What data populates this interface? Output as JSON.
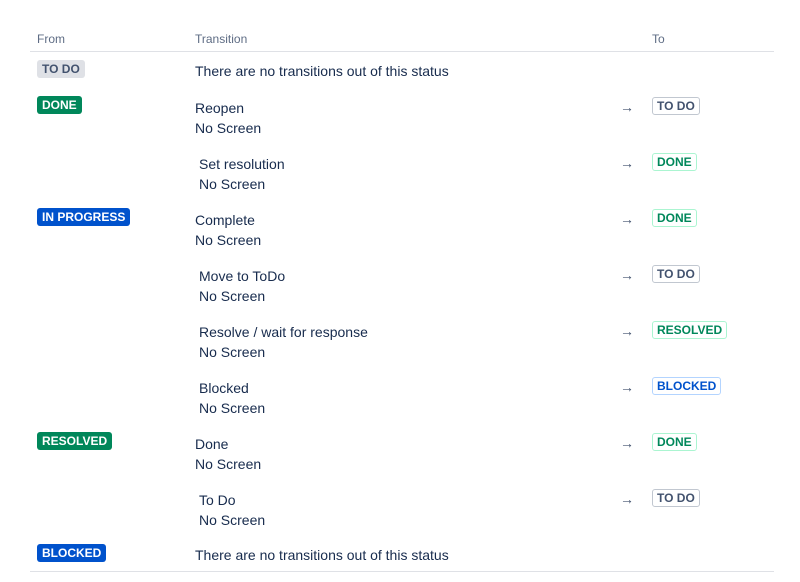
{
  "headers": {
    "from": "From",
    "transition": "Transition",
    "to": "To"
  },
  "arrow": "→",
  "statuses": {
    "todo": "TO DO",
    "done": "DONE",
    "in_progress": "IN PROGRESS",
    "resolved": "RESOLVED",
    "blocked": "BLOCKED"
  },
  "no_transitions": "There are no transitions out of this status",
  "transitions": [
    {
      "name": "Reopen",
      "screen": "No Screen",
      "to": "TO DO"
    },
    {
      "name": "Set resolution",
      "screen": "No Screen",
      "to": "DONE"
    },
    {
      "name": "Complete",
      "screen": "No Screen",
      "to": "DONE"
    },
    {
      "name": "Move to ToDo",
      "screen": "No Screen",
      "to": "TO DO"
    },
    {
      "name": "Resolve / wait for response",
      "screen": "No Screen",
      "to": "RESOLVED"
    },
    {
      "name": "Blocked",
      "screen": "No Screen",
      "to": "BLOCKED"
    },
    {
      "name": "Done",
      "screen": "No Screen",
      "to": "DONE"
    },
    {
      "name": "To Do",
      "screen": "No Screen",
      "to": "TO DO"
    }
  ],
  "colors": {
    "todo_bg": "#dfe1e6",
    "done_bg": "#00875a",
    "in_progress_bg": "#0052cc",
    "blocked_bg": "#0052cc",
    "text": "#172b4d",
    "subtle_text": "#5e6c84"
  }
}
